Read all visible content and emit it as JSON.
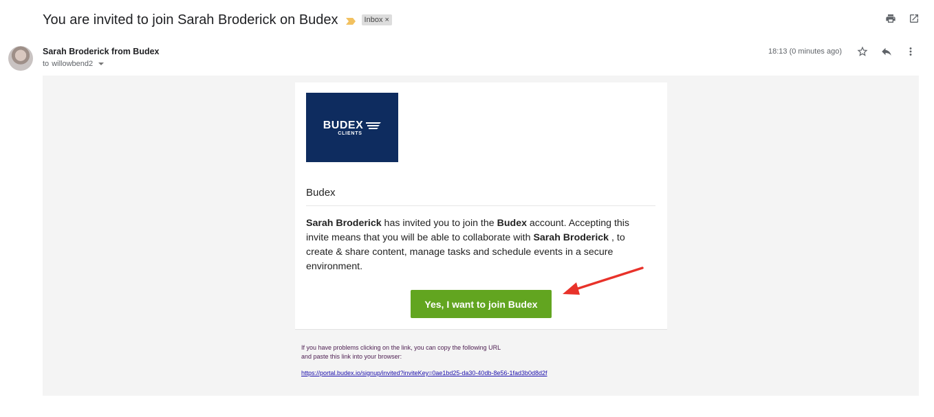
{
  "email": {
    "subject": "You are invited to join Sarah Broderick on Budex",
    "label": "Inbox",
    "label_remove": "×",
    "sender": "Sarah Broderick from Budex",
    "to_prefix": "to",
    "to": "willowbend2",
    "time": "18:13 (0 minutes ago)"
  },
  "body": {
    "logo_text": "BUDEX",
    "logo_sub": "CLIENTS",
    "org_name": "Budex",
    "inviter": "Sarah Broderick",
    "text1": " has invited you to join the ",
    "account": "Budex",
    "text2": " account. Accepting this invite means that you will be able to collaborate with ",
    "inviter2": "Sarah Broderick",
    "text3": " , to create & share content, manage tasks and schedule events in a secure environment.",
    "cta_label": "Yes, I want to join Budex",
    "help_text": "If you have problems clicking on the link, you can copy the following URL and paste this link into your browser:",
    "url": "https://portal.budex.io/signup/invited?inviteKey=0ae1bd25-da30-40db-8e56-1fad3b0d8d2f"
  },
  "icons": {
    "print": "print-icon",
    "open_new": "open-in-new-icon",
    "star": "star-icon",
    "reply": "reply-icon",
    "more": "more-vert-icon",
    "importance": "importance-marker-icon",
    "annotation_arrow": "red-arrow-annotation"
  },
  "colors": {
    "cta": "#62a520",
    "logo_bg": "#0e2c5f",
    "importance": "#f2c160",
    "arrow": "#e8322a"
  }
}
